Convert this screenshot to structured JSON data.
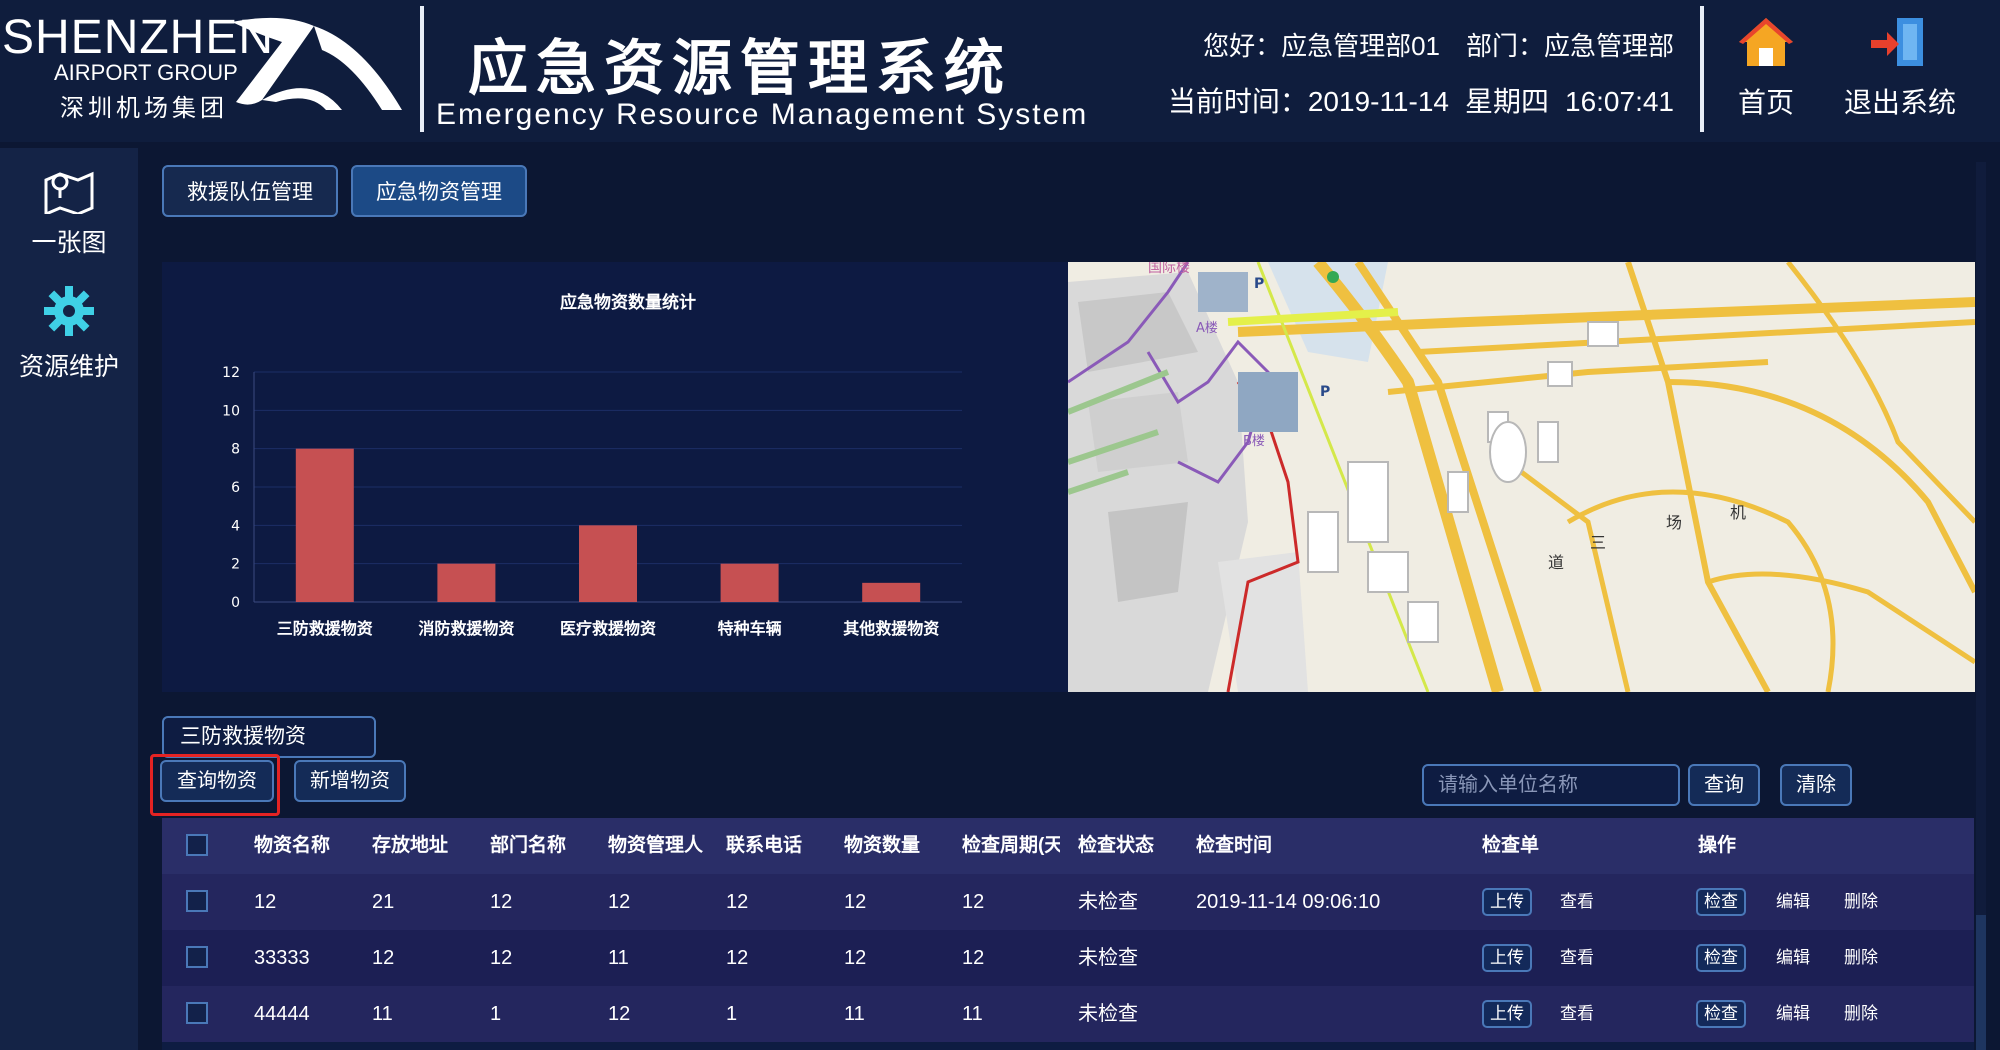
{
  "header": {
    "logo_en": "SHENZHEN",
    "logo_group": "AIRPORT GROUP",
    "logo_cn": "深圳机场集团",
    "title_cn": "应急资源管理系统",
    "title_en": "Emergency Resource Management System",
    "greeting": "您好：应急管理部01",
    "department": "部门：应急管理部",
    "time_label": "当前时间：",
    "date": "2019-11-14",
    "weekday": "星期四",
    "time": "16:07:41",
    "home_label": "首页",
    "logout_label": "退出系统"
  },
  "sidebar": {
    "items": [
      {
        "label": "一张图",
        "icon": "map-icon"
      },
      {
        "label": "资源维护",
        "icon": "gear-icon"
      }
    ]
  },
  "tabs": [
    {
      "label": "救援队伍管理",
      "active": false
    },
    {
      "label": "应急物资管理",
      "active": true
    }
  ],
  "chart_data": {
    "type": "bar",
    "title": "应急物资数量统计",
    "categories": [
      "三防救援物资",
      "消防救援物资",
      "医疗救援物资",
      "特种车辆",
      "其他救援物资"
    ],
    "values": [
      8,
      2,
      4,
      2,
      1
    ],
    "yticks": [
      0,
      2,
      4,
      6,
      8,
      10,
      12
    ],
    "ylim": [
      0,
      12
    ],
    "bar_color": "#c65052",
    "grid": true
  },
  "map": {
    "labels": [
      "国际楼",
      "A楼",
      "B楼",
      "P",
      "P",
      "道",
      "三",
      "场",
      "机"
    ]
  },
  "filter": {
    "category": "三防救援物资",
    "query_button": "查询物资",
    "add_button": "新增物资",
    "search_placeholder": "请输入单位名称",
    "search_button": "查询",
    "clear_button": "清除"
  },
  "table": {
    "columns": [
      "物资名称",
      "存放地址",
      "部门名称",
      "物资管理人",
      "联系电话",
      "物资数量",
      "检查周期(天)",
      "检查状态",
      "检查时间",
      "检查单",
      "操作"
    ],
    "rows": [
      {
        "name": "12",
        "addr": "21",
        "dept": "12",
        "manager": "12",
        "phone": "12",
        "qty": "12",
        "cycle": "12",
        "status": "未检查",
        "time": "2019-11-14 09:06:10"
      },
      {
        "name": "33333",
        "addr": "12",
        "dept": "12",
        "manager": "11",
        "phone": "12",
        "qty": "12",
        "cycle": "12",
        "status": "未检查",
        "time": ""
      },
      {
        "name": "44444",
        "addr": "11",
        "dept": "1",
        "manager": "12",
        "phone": "1",
        "qty": "11",
        "cycle": "11",
        "status": "未检查",
        "time": ""
      }
    ],
    "upload": "上传",
    "view": "查看",
    "check": "检查",
    "edit": "编辑",
    "delete": "删除"
  }
}
